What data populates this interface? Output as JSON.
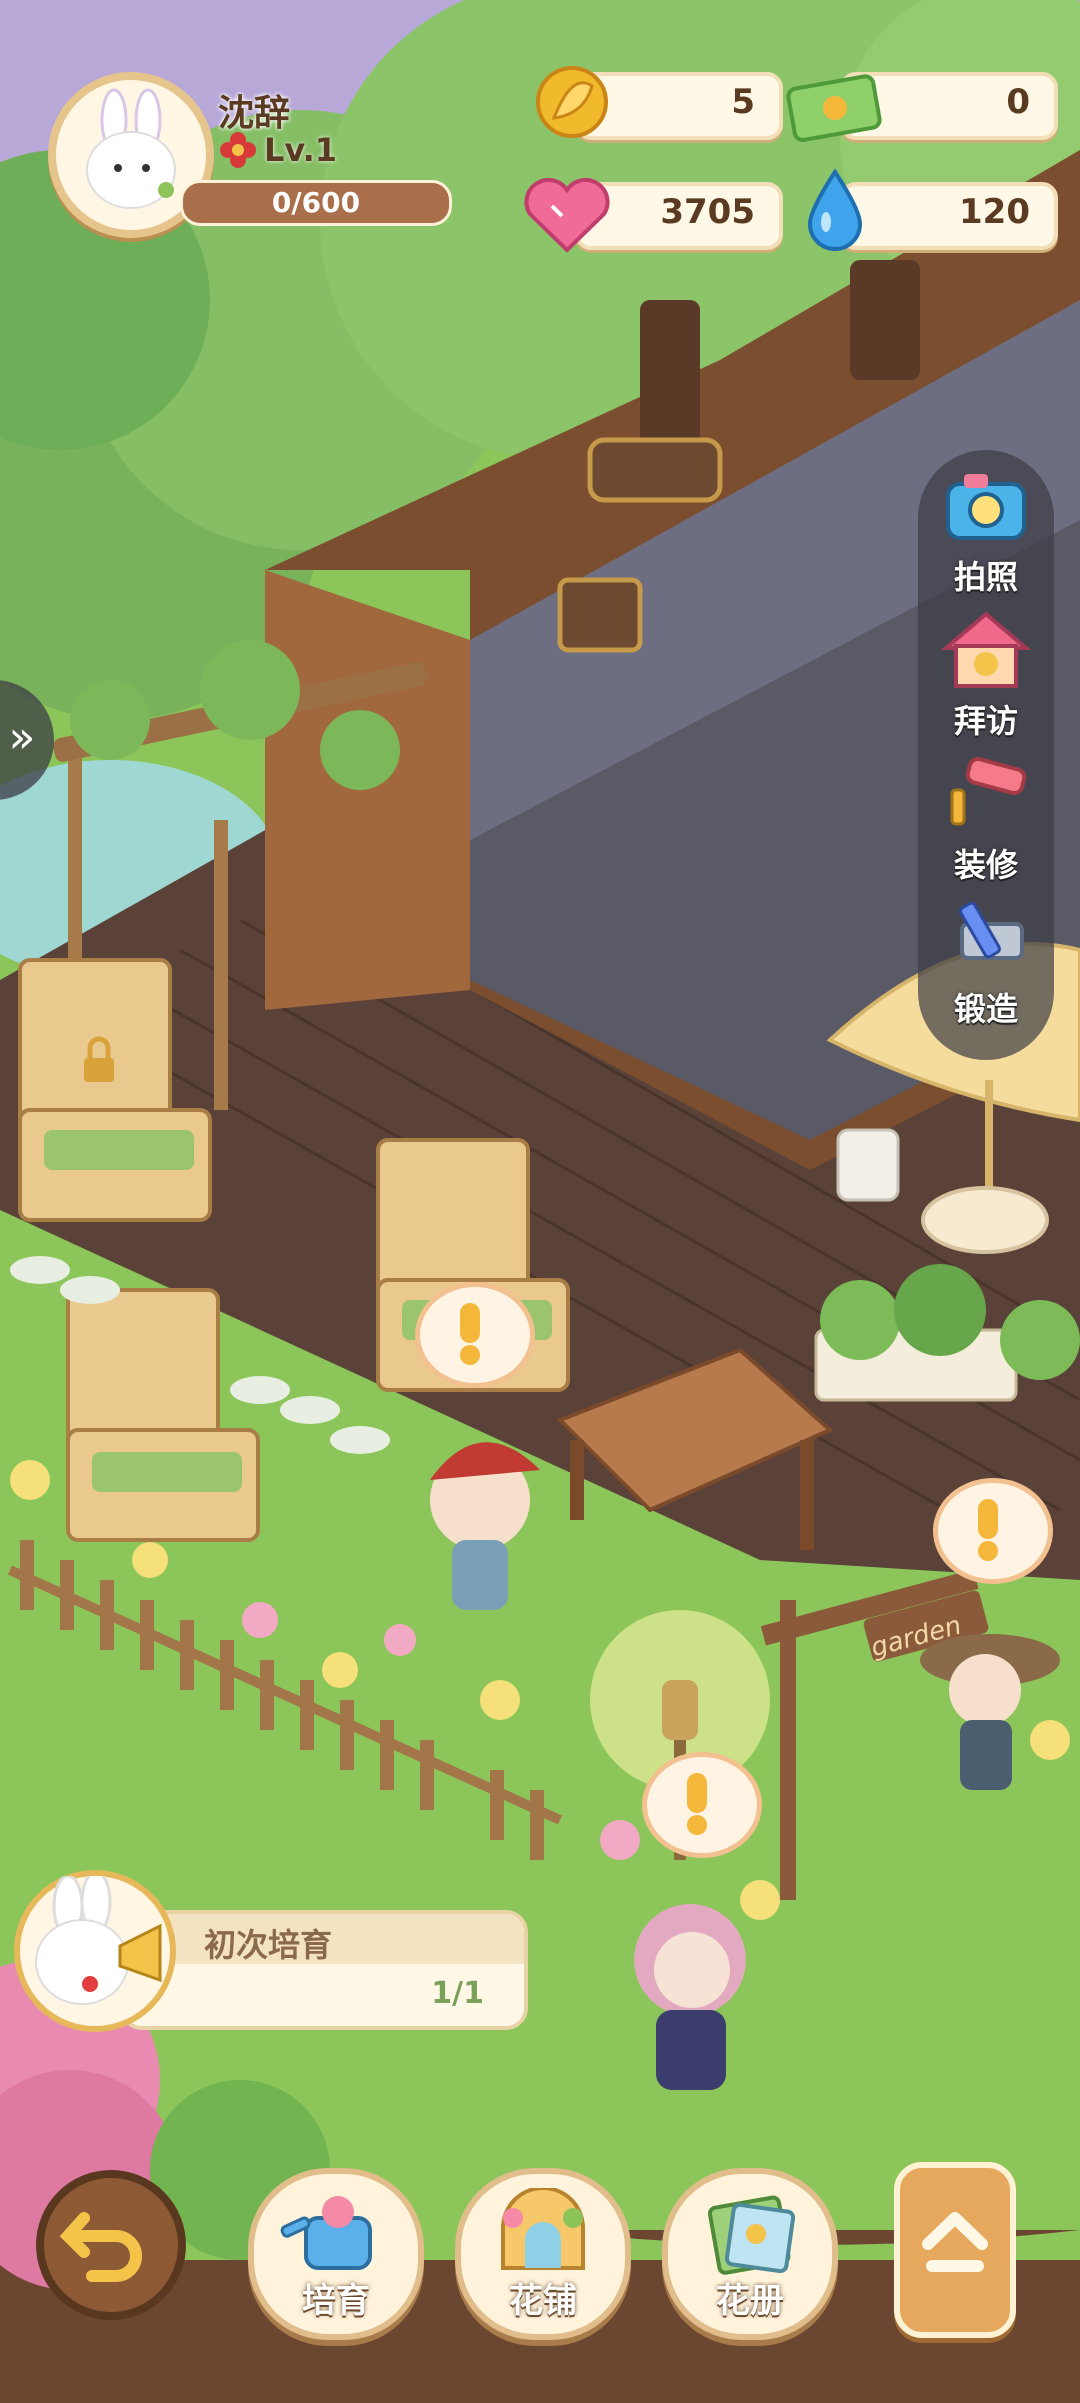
{
  "player": {
    "name": "沈辞",
    "level": "Lv.1",
    "xp_text": "0/600",
    "xp_fraction": 0
  },
  "resources": [
    {
      "name": "leaf",
      "icon": "leaf-icon",
      "value": "5"
    },
    {
      "name": "ticket",
      "icon": "ticket-icon",
      "value": "0"
    },
    {
      "name": "heart",
      "icon": "heart-icon",
      "value": "3705"
    },
    {
      "name": "water",
      "icon": "water-drop-icon",
      "value": "120"
    }
  ],
  "side_menu": [
    {
      "label": "拍照",
      "icon": "camera-icon"
    },
    {
      "label": "拜访",
      "icon": "house-icon"
    },
    {
      "label": "装修",
      "icon": "paint-roller-icon"
    },
    {
      "label": "锻造",
      "icon": "forge-pencil-icon"
    }
  ],
  "quest": {
    "title": "初次培育",
    "progress": "1/1"
  },
  "bottom_bar": [
    {
      "label": "培育",
      "icon": "watering-can-icon"
    },
    {
      "label": "花铺",
      "icon": "flower-shop-icon"
    },
    {
      "label": "花册",
      "icon": "flower-book-icon"
    }
  ],
  "scene": {
    "garden_sign": "garden"
  },
  "colors": {
    "grass": "#8cc55a",
    "deck": "#5b4238",
    "accent_brown": "#8e5a36",
    "panel_dark": "#3c3c46"
  }
}
